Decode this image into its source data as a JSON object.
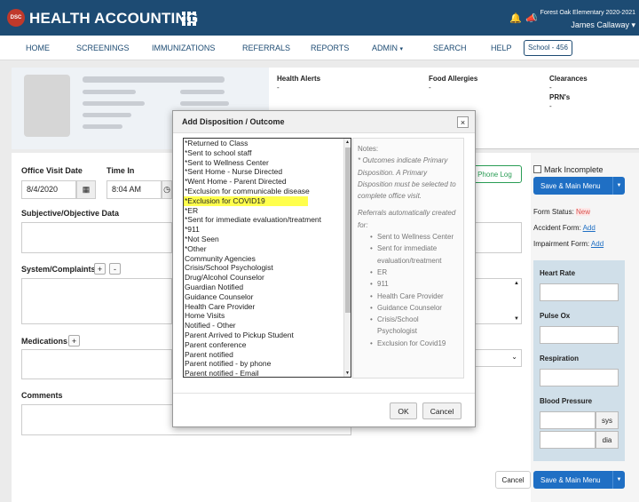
{
  "header": {
    "logo_text": "DSC",
    "app_title": "HEALTH ACCOUNTING",
    "school_name": "Forest Oak Elementary 2020-2021",
    "user_name": "James Callaway"
  },
  "nav": {
    "items": [
      "HOME",
      "SCREENINGS",
      "IMMUNIZATIONS",
      "REFERRALS",
      "REPORTS",
      "ADMIN",
      "SEARCH",
      "HELP"
    ],
    "school_badge": "School - 456"
  },
  "student": {
    "health_alerts_label": "Health Alerts",
    "health_alerts_value": "-",
    "food_allergies_label": "Food Allergies",
    "food_allergies_value": "-",
    "clearances_label": "Clearances",
    "clearances_value": "-",
    "prns_label": "PRN's",
    "prns_value": "-"
  },
  "form": {
    "office_visit_date_label": "Office Visit Date",
    "office_visit_date_value": "8/4/2020",
    "time_in_label": "Time In",
    "time_in_value": "8:04 AM",
    "subjective_label": "Subjective/Objective Data",
    "system_label": "System/Complaints",
    "medications_label": "Medications",
    "comments_label": "Comments",
    "plus": "+",
    "minus": "-",
    "phone_log": "+ Phone Log",
    "cancel": "Cancel"
  },
  "side": {
    "mark_incomplete": "Mark Incomplete",
    "save_main_menu": "Save & Main Menu",
    "form_status_label": "Form Status:",
    "form_status_value": "New",
    "accident_form_label": "Accident Form:",
    "impairment_form_label": "Impairment Form:",
    "add_link": "Add"
  },
  "vitals": {
    "heart_rate": "Heart Rate",
    "pulse_ox": "Pulse Ox",
    "respiration": "Respiration",
    "blood_pressure": "Blood Pressure",
    "sys": "sys",
    "dia": "dia"
  },
  "modal": {
    "title": "Add Disposition / Outcome",
    "close": "×",
    "options": [
      "*Returned to Class",
      "*Sent to school staff",
      "*Sent to Wellness Center",
      "*Sent Home - Nurse Directed",
      "*Went Home - Parent Directed",
      "*Exclusion for communicable disease",
      "*Exclusion for COVID19",
      "*ER",
      "*Sent for immediate evaluation/treatment",
      "*911",
      "*Not Seen",
      "*Other",
      "Community Agencies",
      "Crisis/School Psychologist",
      "Drug/Alcohol Counselor",
      "Guardian Notified",
      "Guidance Counselor",
      "Health Care Provider",
      "Home Visits",
      "Notified - Other",
      "Parent Arrived to Pickup Student",
      "Parent conference",
      "Parent notified",
      "Parent notified - by phone",
      "Parent notified - Email"
    ],
    "highlighted_index": 6,
    "highlight_color": "#ffff4d",
    "notes_title": "Notes:",
    "notes_primary": "* Outcomes indicate Primary Disposition. A Primary Disposition must be selected to complete office visit.",
    "notes_referrals": "Referrals automatically created for:",
    "referrals": [
      "Sent to Wellness Center",
      "Sent for immediate evaluation/treatment",
      "ER",
      "911",
      "Health Care Provider",
      "Guidance Counselor",
      "Crisis/School Psychologist",
      "Exclusion for Covid19"
    ],
    "ok": "OK",
    "cancel": "Cancel"
  },
  "colors": {
    "header_bg": "#1d4b73",
    "primary_button": "#1f6fc4",
    "status_new": "#d9534f",
    "phone_log": "#2a9d55"
  }
}
